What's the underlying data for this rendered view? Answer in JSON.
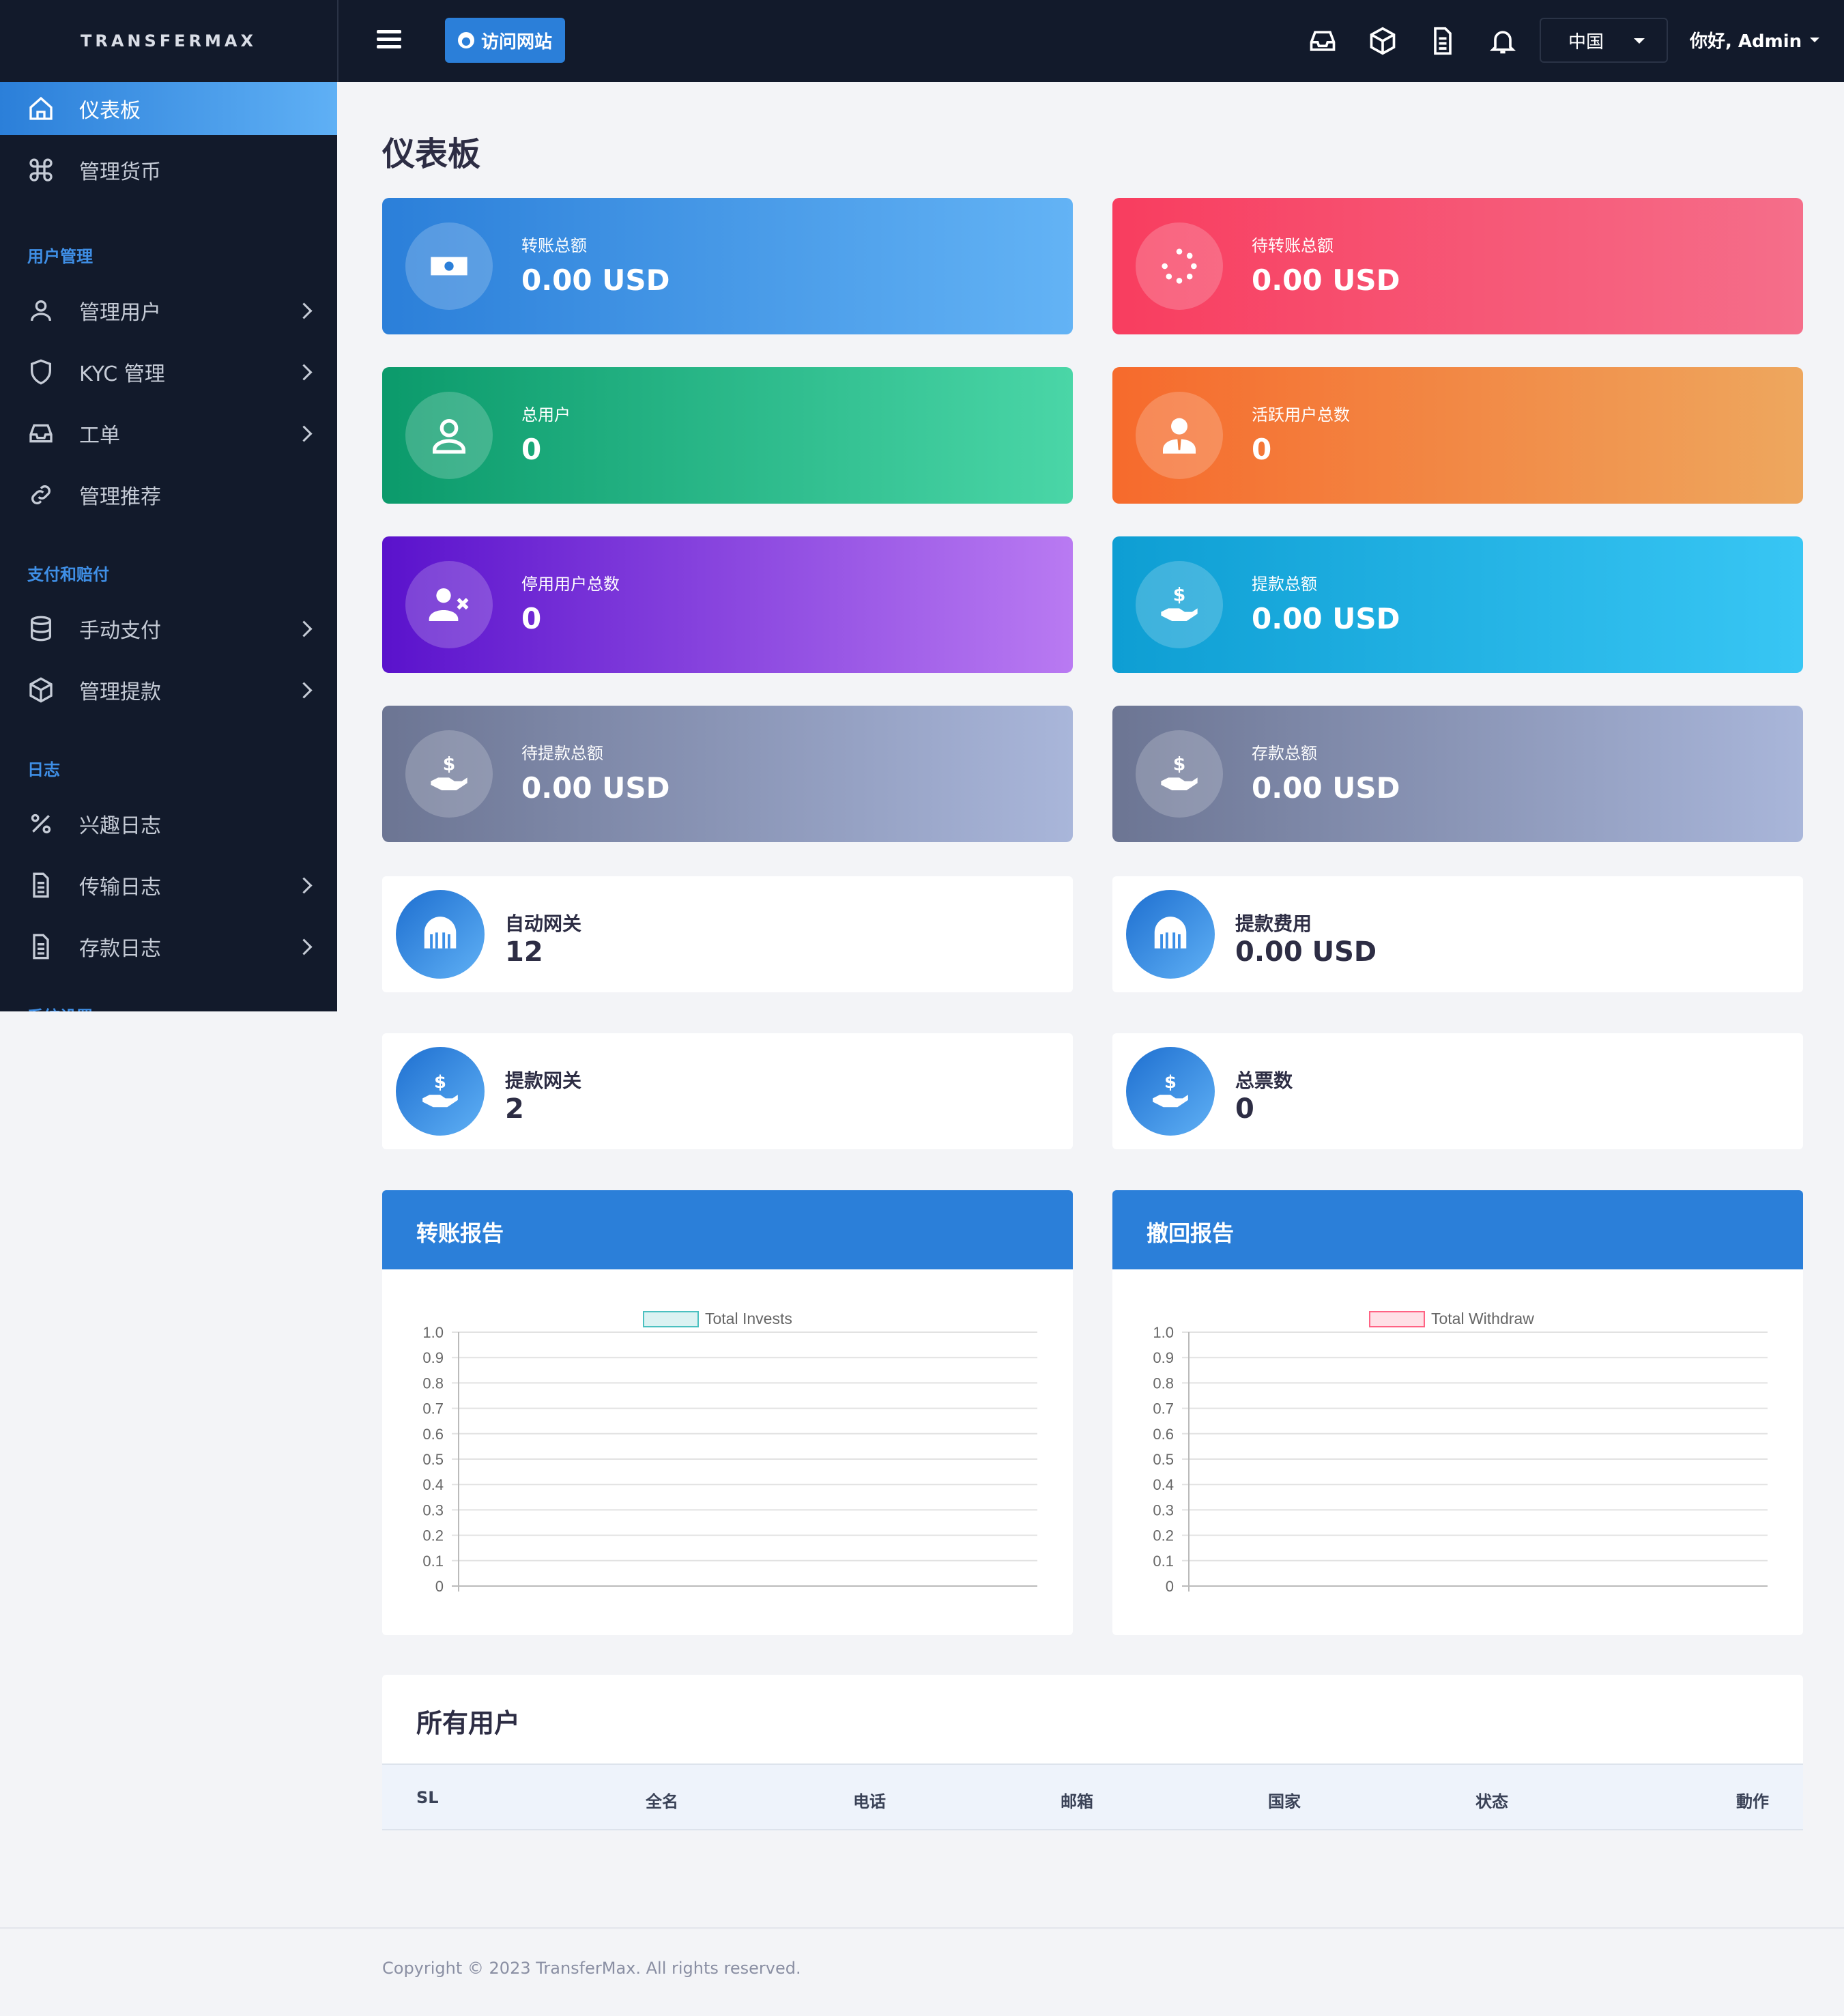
{
  "brand": "TRANSFERMAX",
  "header": {
    "visit_site": "访问网站",
    "language": "中国",
    "user_greeting": "你好, Admin",
    "icons": [
      "inbox-icon",
      "box-icon",
      "document-icon",
      "bell-icon"
    ]
  },
  "sidebar": {
    "items": [
      {
        "label": "仪表板",
        "icon": "home-icon",
        "active": true
      },
      {
        "label": "管理货币",
        "icon": "command-icon"
      },
      {
        "label": "管理用户",
        "icon": "user-icon",
        "has_children": true
      },
      {
        "label": "KYC 管理",
        "icon": "shield-icon",
        "has_children": true
      },
      {
        "label": "工单",
        "icon": "inbox-icon",
        "has_children": true
      },
      {
        "label": "管理推荐",
        "icon": "link-icon"
      },
      {
        "label": "手动支付",
        "icon": "database-icon",
        "has_children": true
      },
      {
        "label": "管理提款",
        "icon": "box-icon",
        "has_children": true
      },
      {
        "label": "兴趣日志",
        "icon": "percent-icon"
      },
      {
        "label": "传输日志",
        "icon": "file-icon",
        "has_children": true
      },
      {
        "label": "存款日志",
        "icon": "file-icon",
        "has_children": true
      }
    ],
    "sections": [
      "用户管理",
      "支付和赔付",
      "日志",
      "系统设置"
    ]
  },
  "page_title": "仪表板",
  "stat_cards": [
    {
      "label": "转账总额",
      "value": "0.00 USD",
      "icon": "money-icon",
      "gradient": [
        "#2b7fd9",
        "#63b3f5"
      ]
    },
    {
      "label": "待转账总额",
      "value": "0.00 USD",
      "icon": "spinner-icon",
      "gradient": [
        "#f83d5f",
        "#f56e8a"
      ]
    },
    {
      "label": "总用户",
      "value": "0",
      "icon": "user-icon",
      "gradient": [
        "#0b9a6b",
        "#4ad6a7"
      ]
    },
    {
      "label": "活跃用户总数",
      "value": "0",
      "icon": "user-tie-icon",
      "gradient": [
        "#f66a2c",
        "#eea75e"
      ]
    },
    {
      "label": "停用用户总数",
      "value": "0",
      "icon": "user-times-icon",
      "gradient": [
        "#5a12cc",
        "#b97af2"
      ]
    },
    {
      "label": "提款总额",
      "value": "0.00 USD",
      "icon": "hand-dollar-icon",
      "gradient": [
        "#0e9ed3",
        "#38c6f4"
      ]
    },
    {
      "label": "待提款总额",
      "value": "0.00 USD",
      "icon": "hand-dollar-icon",
      "gradient": [
        "#6c7593",
        "#a9b6da"
      ]
    },
    {
      "label": "存款总额",
      "value": "0.00 USD",
      "icon": "hand-dollar-icon",
      "gradient": [
        "#6c7593",
        "#a9b6da"
      ]
    }
  ],
  "white_cards": [
    {
      "label": "自动网关",
      "value": "12",
      "icon": "gateway-icon"
    },
    {
      "label": "提款费用",
      "value": "0.00 USD",
      "icon": "gateway-icon"
    },
    {
      "label": "提款网关",
      "value": "2",
      "icon": "hand-dollar-icon"
    },
    {
      "label": "总票数",
      "value": "0",
      "icon": "hand-dollar-icon"
    }
  ],
  "charts": [
    {
      "title": "转账报告"
    },
    {
      "title": "撤回报告"
    }
  ],
  "chart_data": [
    {
      "type": "bar",
      "series": [
        {
          "name": "Total Invests",
          "values": [],
          "color": "#4bc0c0"
        }
      ],
      "categories": [],
      "ylim": [
        0,
        1
      ],
      "yticks": [
        "1.0",
        "0.9",
        "0.8",
        "0.7",
        "0.6",
        "0.5",
        "0.4",
        "0.3",
        "0.2",
        "0.1",
        "0"
      ],
      "legend_position": "top"
    },
    {
      "type": "bar",
      "series": [
        {
          "name": "Total Withdraw",
          "values": [],
          "color": "#ff6384"
        }
      ],
      "categories": [],
      "ylim": [
        0,
        1
      ],
      "yticks": [
        "1.0",
        "0.9",
        "0.8",
        "0.7",
        "0.6",
        "0.5",
        "0.4",
        "0.3",
        "0.2",
        "0.1",
        "0"
      ],
      "legend_position": "top"
    }
  ],
  "users_table": {
    "title": "所有用户",
    "columns": [
      "SL",
      "全名",
      "电话",
      "邮箱",
      "国家",
      "状态",
      "動作"
    ],
    "rows": []
  },
  "footer": {
    "copyright": "Copyright © 2023 TransferMax. All rights reserved."
  }
}
